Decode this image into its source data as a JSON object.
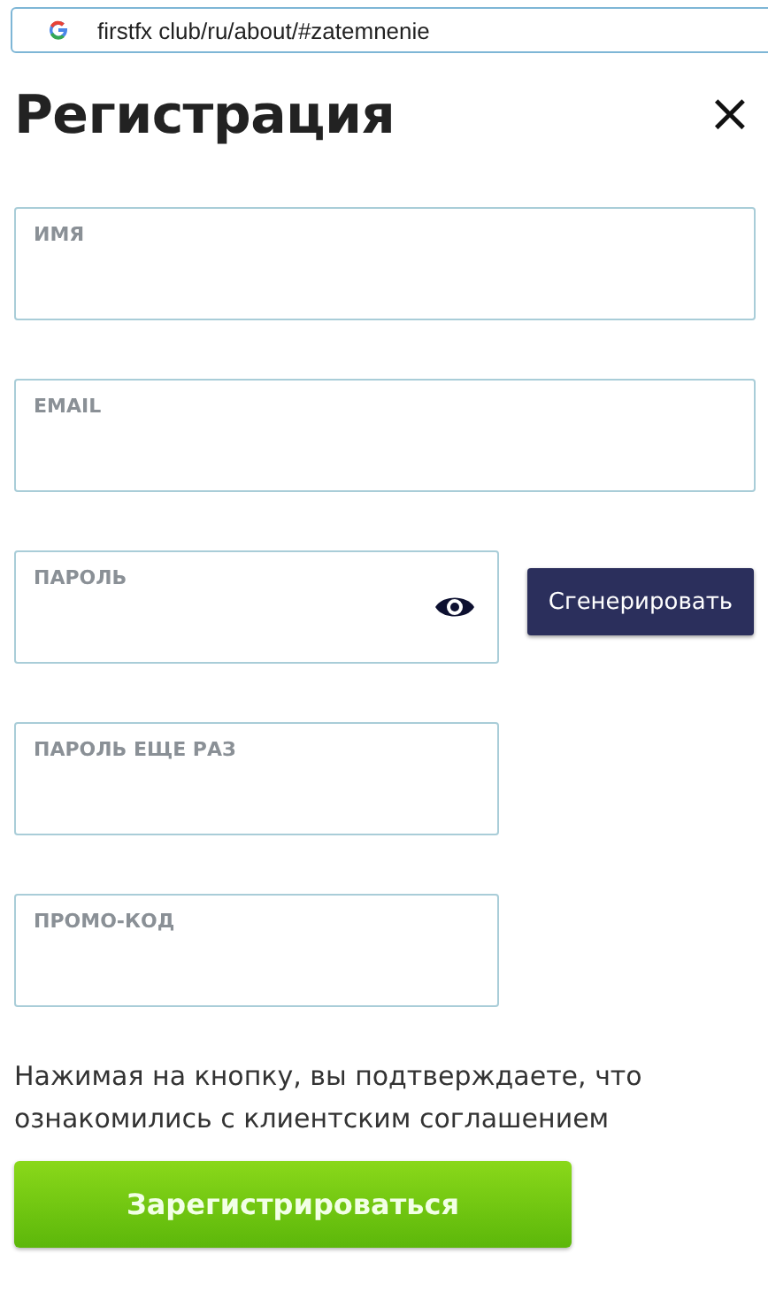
{
  "address_bar": {
    "url": "firstfx club/ru/about/#zatemnenie"
  },
  "title": "Регистрация",
  "close": "×",
  "fields": [
    {
      "label": "ИМЯ",
      "kind": "full"
    },
    {
      "label": "EMAIL",
      "kind": "full"
    },
    {
      "label": "ПАРОЛЬ",
      "kind": "password",
      "action": "Сгенерировать"
    },
    {
      "label": "ПАРОЛЬ ЕЩЕ РАЗ",
      "kind": "half"
    },
    {
      "label": "ПРОМО-КОД",
      "kind": "half"
    }
  ],
  "notice": "Нажимая на кнопку, вы подтверждаете, что ознакомились с клиентским соглашением",
  "submit": "Зарегистрироваться"
}
